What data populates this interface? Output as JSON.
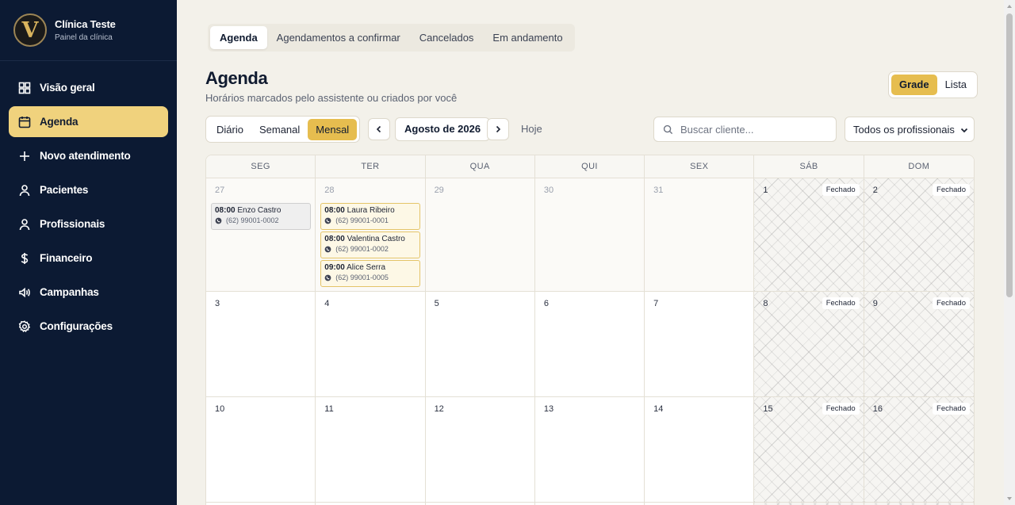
{
  "brand": {
    "logo_letter": "V",
    "title": "Clínica Teste",
    "subtitle": "Painel da clínica"
  },
  "sidebar": {
    "items": [
      {
        "label": "Visão geral",
        "icon": "dashboard-grid-icon"
      },
      {
        "label": "Agenda",
        "icon": "calendar-icon",
        "active": true
      },
      {
        "label": "Novo atendimento",
        "icon": "plus-icon"
      },
      {
        "label": "Pacientes",
        "icon": "user-icon"
      },
      {
        "label": "Profissionais",
        "icon": "user-icon"
      },
      {
        "label": "Financeiro",
        "icon": "dollar-icon"
      },
      {
        "label": "Campanhas",
        "icon": "megaphone-icon"
      },
      {
        "label": "Configurações",
        "icon": "gear-icon"
      }
    ]
  },
  "tabs": [
    "Agenda",
    "Agendamentos a confirmar",
    "Cancelados",
    "Em andamento"
  ],
  "header": {
    "title": "Agenda",
    "subtitle": "Horários marcados pelo assistente ou criados por você"
  },
  "view_toggle": {
    "grid": "Grade",
    "list": "Lista",
    "selected": "Grade"
  },
  "range": {
    "daily": "Diário",
    "weekly": "Semanal",
    "monthly": "Mensal",
    "selected": "Mensal"
  },
  "month_label": "Agosto de 2026",
  "today_label": "Hoje",
  "search": {
    "placeholder": "Buscar cliente...",
    "value": ""
  },
  "professional_filter": {
    "selected": "Todos os profissionais"
  },
  "calendar": {
    "day_names": [
      "SEG",
      "TER",
      "QUA",
      "QUI",
      "SEX",
      "SÁB",
      "DOM"
    ],
    "closed_label": "Fechado",
    "weeks": [
      [
        {
          "day": "27",
          "out": true
        },
        {
          "day": "28",
          "out": true
        },
        {
          "day": "29",
          "out": true
        },
        {
          "day": "30",
          "out": true
        },
        {
          "day": "31",
          "out": true
        },
        {
          "day": "1",
          "closed": true
        },
        {
          "day": "2",
          "closed": true
        }
      ],
      [
        {
          "day": "3"
        },
        {
          "day": "4"
        },
        {
          "day": "5"
        },
        {
          "day": "6"
        },
        {
          "day": "7"
        },
        {
          "day": "8",
          "closed": true
        },
        {
          "day": "9",
          "closed": true
        }
      ],
      [
        {
          "day": "10"
        },
        {
          "day": "11"
        },
        {
          "day": "12"
        },
        {
          "day": "13"
        },
        {
          "day": "14"
        },
        {
          "day": "15",
          "closed": true
        },
        {
          "day": "16",
          "closed": true
        }
      ],
      [
        {
          "day": ""
        },
        {
          "day": ""
        },
        {
          "day": ""
        },
        {
          "day": ""
        },
        {
          "day": ""
        },
        {
          "day": "",
          "closed": true
        },
        {
          "day": "",
          "closed": true
        }
      ]
    ],
    "events": [
      {
        "week": 0,
        "col": 0,
        "slot": 0,
        "time": "08:00",
        "name": "Enzo Castro",
        "phone": "(62) 99001-0002",
        "style": "gray"
      },
      {
        "week": 0,
        "col": 1,
        "slot": 0,
        "time": "08:00",
        "name": "Laura Ribeiro",
        "phone": "(62) 99001-0001",
        "style": "yellow"
      },
      {
        "week": 0,
        "col": 1,
        "slot": 1,
        "time": "08:00",
        "name": "Valentina Castro",
        "phone": "(62) 99001-0002",
        "style": "yellow"
      },
      {
        "week": 0,
        "col": 1,
        "slot": 2,
        "time": "09:00",
        "name": "Alice Serra",
        "phone": "(62) 99001-0005",
        "style": "yellow"
      }
    ]
  },
  "colors": {
    "sidebar_bg": "#0c1a33",
    "accent": "#e6bd4f",
    "active_nav": "#f0d27d",
    "page_bg": "#f3f1ea"
  }
}
